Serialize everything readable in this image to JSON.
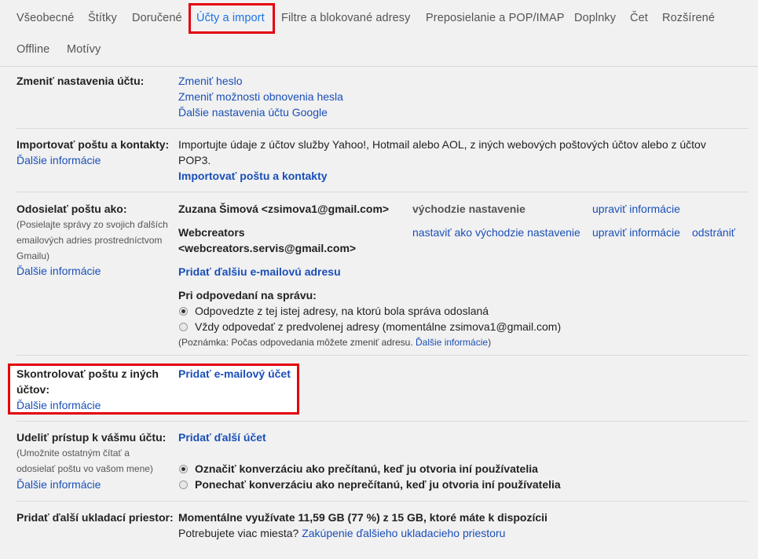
{
  "tabs": [
    {
      "label": "Všeobecné"
    },
    {
      "label": "Štítky"
    },
    {
      "label": "Doručené"
    },
    {
      "label": "Účty a import"
    },
    {
      "label": "Filtre a blokované adresy"
    },
    {
      "label": "Preposielanie a POP/IMAP"
    },
    {
      "label": "Doplnky"
    },
    {
      "label": "Čet"
    },
    {
      "label": "Rozšírené"
    },
    {
      "label": "Offline"
    },
    {
      "label": "Motívy"
    }
  ],
  "change_account": {
    "label": "Zmeniť nastavenia účtu:",
    "links": [
      "Zmeniť heslo",
      "Zmeniť možnosti obnovenia hesla",
      "Ďalšie nastavenia účtu Google"
    ]
  },
  "import_mail": {
    "label": "Importovať poštu a kontakty:",
    "more": "Ďalšie informácie",
    "desc_line1": "Importujte údaje z účtov služby Yahoo!, Hotmail alebo AOL, z iných webových poštových účtov alebo z účtov",
    "desc_line2": "POP3.",
    "action": "Importovať poštu a kontakty"
  },
  "send_as": {
    "label": "Odosielať poštu ako:",
    "desc": [
      "(Posielajte správy zo svojich ďalších",
      "emailových adries prostredníctvom",
      "Gmailu)"
    ],
    "more": "Ďalšie informácie",
    "addr1": "Zuzana Šimová <zsimova1@gmail.com>",
    "addr1_status": "východzie nastavenie",
    "addr1_edit": "upraviť informácie",
    "addr2_line1": "Webcreators",
    "addr2_line2": "<webcreators.servis@gmail.com>",
    "addr2_make_default": "nastaviť ako východzie nastavenie",
    "addr2_edit": "upraviť informácie",
    "addr2_delete": "odstrániť",
    "add_address": "Pridať ďalšiu e-mailovú adresu",
    "reply_title": "Pri odpovedaní na správu:",
    "reply_opt1": "Odpovedzte z tej istej adresy, na ktorú bola správa odoslaná",
    "reply_opt2": "Vždy odpovedať z predvolenej adresy (momentálne zsimova1@gmail.com)",
    "note": "(Poznámka: Počas odpovedania môžete zmeniť adresu.",
    "note_link": "Ďalšie informácie",
    "note_end": ")"
  },
  "check_mail": {
    "label_line1": "Skontrolovať poštu z iných",
    "label_line2": "účtov:",
    "more": "Ďalšie informácie",
    "action": "Pridať e-mailový účet"
  },
  "grant_access": {
    "label": "Udeliť prístup k vášmu účtu:",
    "desc": [
      "(Umožnite ostatným čítať a",
      "odosielať poštu vo vašom mene)"
    ],
    "more": "Ďalšie informácie",
    "action": "Pridať ďalší účet",
    "opt1": "Označiť konverzáciu ako prečítanú, keď ju otvoria iní používatelia",
    "opt2": "Ponechať konverzáciu ako neprečítanú, keď ju otvoria iní používatelia"
  },
  "storage": {
    "label": "Pridať ďalší ukladací priestor:",
    "usage": "Momentálne využívate 11,59 GB (77 %) z 15 GB, ktoré máte k dispozícii",
    "question": "Potrebujete viac miesta?",
    "link": "Zakúpenie ďalšieho ukladacieho priestoru"
  }
}
